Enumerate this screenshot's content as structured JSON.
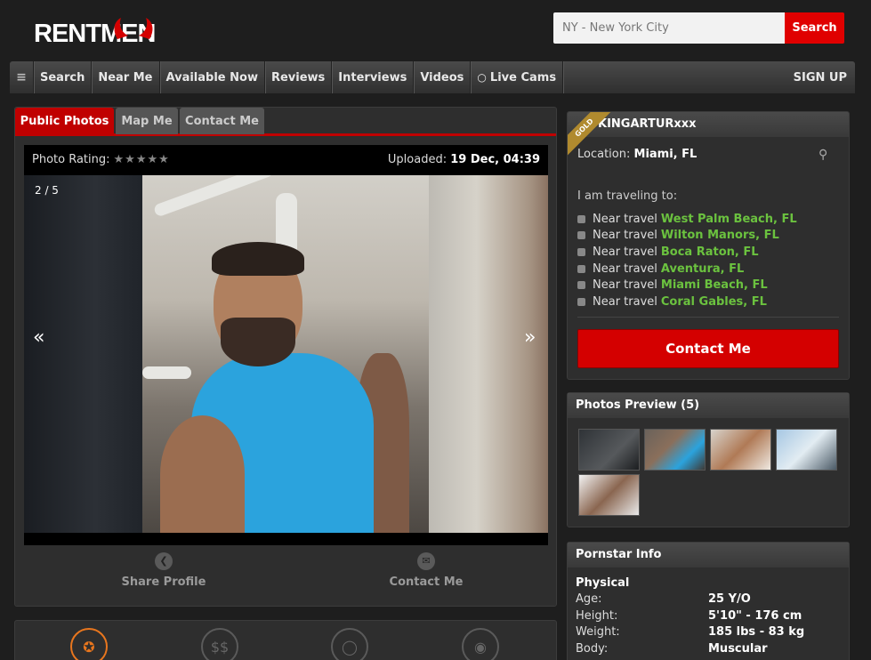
{
  "header": {
    "logo": "RENTMEN",
    "search_placeholder": "NY - New York City",
    "search_button": "Search"
  },
  "nav": {
    "menu_icon": "≡",
    "items": [
      "Search",
      "Near Me",
      "Available Now",
      "Reviews",
      "Interviews",
      "Videos",
      "Live Cams"
    ],
    "signup": "SIGN UP"
  },
  "tabs": [
    "Public Photos",
    "Map Me",
    "Contact Me"
  ],
  "photo": {
    "rating_label": "Photo Rating:",
    "stars": "★★★★★",
    "uploaded_label": "Uploaded:",
    "uploaded_value": "19 Dec, 04:39",
    "counter": "2 / 5",
    "prev": "«",
    "next": "»"
  },
  "actions": {
    "share": "Share Profile",
    "contact": "Contact Me"
  },
  "profile": {
    "badge": "GOLD",
    "username": "KINGARTURxxx",
    "location_label": "Location:",
    "location_value": "Miami, FL",
    "traveling_label": "I am traveling to:",
    "near_label": "Near travel",
    "travel_cities": [
      "West Palm Beach, FL",
      "Wilton Manors, FL",
      "Boca Raton, FL",
      "Aventura, FL",
      "Miami Beach, FL",
      "Coral Gables, FL"
    ],
    "contact_button": "Contact Me"
  },
  "preview": {
    "title": "Photos Preview (5)"
  },
  "info": {
    "title": "Pornstar Info",
    "section": "Physical",
    "rows": [
      {
        "label": "Age:",
        "value": "25 Y/O"
      },
      {
        "label": "Height:",
        "value": "5'10\" - 176 cm"
      },
      {
        "label": "Weight:",
        "value": "185 lbs - 83 kg"
      },
      {
        "label": "Body:",
        "value": "Muscular"
      }
    ]
  },
  "colors": {
    "accent": "#c00000",
    "city_green": "#6bc23f",
    "gold": "#b08a2e"
  }
}
